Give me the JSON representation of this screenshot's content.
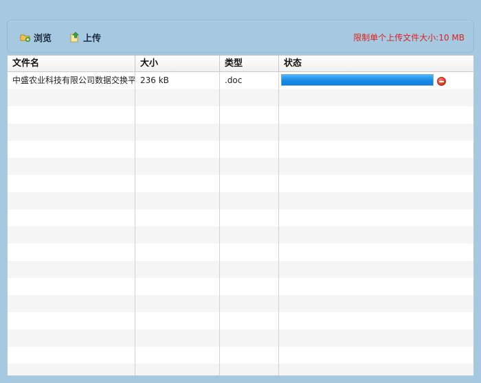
{
  "toolbar": {
    "browse_label": "浏览",
    "upload_label": "上传",
    "limit_text": "限制单个上传文件大小:10 MB"
  },
  "grid": {
    "columns": [
      "文件名",
      "大小",
      "类型",
      "状态"
    ],
    "files": [
      {
        "name": "中盛农业科技有限公司数据交换平",
        "size": "236 kB",
        "type": ".doc",
        "progress_fraction": 1.0
      }
    ]
  },
  "colors": {
    "background": "#a6c9e2",
    "limit_text": "#e0201b",
    "progress_fill": "#1d8de8",
    "row_alt": "#f5f5f5"
  },
  "icons": [
    "browse-folder-icon",
    "upload-icon",
    "remove-icon"
  ]
}
